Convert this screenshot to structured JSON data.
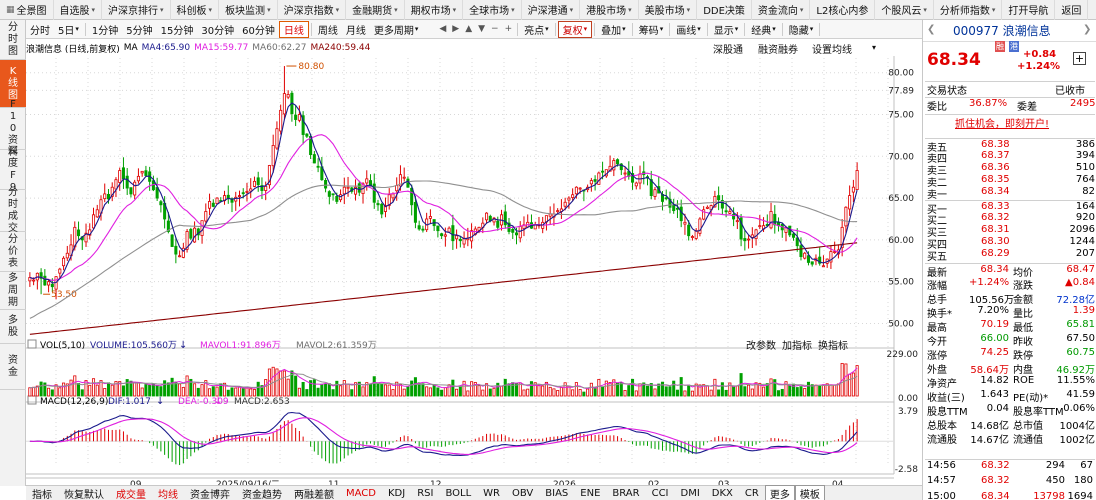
{
  "top_menu": [
    {
      "label": "全景图",
      "icon": "grid-icon"
    },
    {
      "label": "自选股",
      "dd": true
    },
    {
      "label": "沪深京排行",
      "dd": true
    },
    {
      "label": "科创板",
      "dd": true
    },
    {
      "label": "板块监测",
      "dd": true
    },
    {
      "label": "沪深京指数",
      "dd": true
    },
    {
      "label": "金融期货",
      "dd": true
    },
    {
      "label": "期权市场",
      "dd": true
    },
    {
      "label": "全球市场",
      "dd": true
    },
    {
      "label": "沪深港通",
      "dd": true
    },
    {
      "label": "港股市场",
      "dd": true
    },
    {
      "label": "美股市场",
      "dd": true
    },
    {
      "label": "DDE决策",
      "dd": false
    },
    {
      "label": "资金流向",
      "dd": true
    },
    {
      "label": "L2核心内参",
      "dd": false
    },
    {
      "label": "个股风云",
      "dd": true
    },
    {
      "label": "分析师指数",
      "dd": true
    },
    {
      "label": "打开导航",
      "dd": false
    },
    {
      "label": "返回",
      "dd": false
    }
  ],
  "toolbar": {
    "periods": [
      "分时",
      "5日",
      "1分钟",
      "5分钟",
      "15分钟",
      "30分钟",
      "60分钟",
      "日线",
      "周线",
      "月线",
      "更多周期"
    ],
    "active_period": "日线",
    "tools": [
      "亮点",
      "复权",
      "叠加",
      "筹码",
      "画线",
      "显示",
      "经典",
      "隐藏"
    ]
  },
  "left_tabs": [
    {
      "label": "分时图",
      "active": false
    },
    {
      "label": "K线图",
      "active": true
    },
    {
      "label": "F10资料",
      "active": false
    },
    {
      "label": "深度F9",
      "active": false
    },
    {
      "label": "分时成交",
      "active": false
    },
    {
      "label": "分价表",
      "active": false
    },
    {
      "label": "多周期",
      "active": false
    },
    {
      "label": "多股",
      "active": false
    },
    {
      "label": "资金",
      "active": false
    }
  ],
  "chart_header": {
    "title": "浪潮信息 (日线,前复权)",
    "ma_label": "MA",
    "ma4": "MA4:65.90",
    "ma15": "MA15:59.77",
    "ma60": "MA60:62.27",
    "ma240": "MA240:59.44",
    "buttons": [
      "深股通",
      "融资融券",
      "设置均线"
    ]
  },
  "volume_header": {
    "title": "VOL(5,10)",
    "volume": "VOLUME:105.560万",
    "mavol1": "MAVOL1:91.896万",
    "mavol2": "MAVOL2:61.359万",
    "buttons": [
      "改参数",
      "加指标",
      "换指标"
    ]
  },
  "macd_header": {
    "title": "MACD(12,26,9)",
    "dif": "DIF:1.017",
    "dea": "DEA:-0.309",
    "macd": "MACD:2.653"
  },
  "date_axis": [
    "09",
    "2025/09/16/二",
    "11",
    "12",
    "2026",
    "02",
    "03",
    "04"
  ],
  "bottom_tabs": [
    "指标",
    "恢复默认",
    "成交量",
    "均线",
    "资金博弈",
    "资金趋势",
    "两融差额",
    "MACD",
    "KDJ",
    "RSI",
    "BOLL",
    "WR",
    "OBV",
    "BIAS",
    "ENE",
    "BRAR",
    "CCI",
    "DMI",
    "DKX",
    "CR",
    "更多",
    "模板"
  ],
  "bottom_selected": [
    "成交量",
    "均线",
    "MACD"
  ],
  "quote": {
    "code": "000977 浪潮信息",
    "tags": [
      "融",
      "港"
    ],
    "price": "68.34",
    "change": "+0.84",
    "change_pct": "+1.24%",
    "status_label": "交易状态",
    "status_value": "已收市",
    "weibi_label": "委比",
    "weibi": "36.87%",
    "weicha_label": "委差",
    "weicha": "2495",
    "promo": "抓住机会，即刻开户!",
    "asks": [
      {
        "label": "卖五",
        "price": "68.38",
        "vol": "386"
      },
      {
        "label": "卖四",
        "price": "68.37",
        "vol": "394"
      },
      {
        "label": "卖三",
        "price": "68.36",
        "vol": "510"
      },
      {
        "label": "卖二",
        "price": "68.35",
        "vol": "764"
      },
      {
        "label": "卖一",
        "price": "68.34",
        "vol": "82"
      }
    ],
    "bids": [
      {
        "label": "买一",
        "price": "68.33",
        "vol": "164"
      },
      {
        "label": "买二",
        "price": "68.32",
        "vol": "920"
      },
      {
        "label": "买三",
        "price": "68.31",
        "vol": "2096"
      },
      {
        "label": "买四",
        "price": "68.30",
        "vol": "1244"
      },
      {
        "label": "买五",
        "price": "68.29",
        "vol": "207"
      }
    ],
    "stats": [
      {
        "l1": "最新",
        "v1": "68.34",
        "c1": "red",
        "l2": "均价",
        "v2": "68.47",
        "c2": "red"
      },
      {
        "l1": "涨幅",
        "v1": "+1.24%",
        "c1": "red",
        "l2": "涨跌",
        "v2": "▲0.84",
        "c2": "red"
      },
      {
        "l1": "总手",
        "v1": "105.56万",
        "c1": "",
        "l2": "金额",
        "v2": "72.28亿",
        "c2": "blu"
      },
      {
        "l1": "换手*",
        "v1": "7.20%",
        "c1": "",
        "l2": "量比",
        "v2": "1.39",
        "c2": "red"
      },
      {
        "l1": "最高",
        "v1": "70.19",
        "c1": "red",
        "l2": "最低",
        "v2": "65.81",
        "c2": "grn"
      },
      {
        "l1": "今开",
        "v1": "66.00",
        "c1": "grn",
        "l2": "昨收",
        "v2": "67.50",
        "c2": ""
      },
      {
        "l1": "涨停",
        "v1": "74.25",
        "c1": "red",
        "l2": "跌停",
        "v2": "60.75",
        "c2": "grn"
      },
      {
        "l1": "外盘",
        "v1": "58.64万",
        "c1": "red",
        "l2": "内盘",
        "v2": "46.92万",
        "c2": "grn"
      },
      {
        "l1": "净资产",
        "v1": "14.82",
        "c1": "",
        "l2": "ROE",
        "v2": "11.55%",
        "c2": ""
      },
      {
        "l1": "收益(三)",
        "v1": "1.643",
        "c1": "",
        "l2": "PE(动)*",
        "v2": "41.59",
        "c2": ""
      },
      {
        "l1": "股息TTM",
        "v1": "0.04",
        "c1": "",
        "l2": "股息率TTM",
        "v2": "0.06%",
        "c2": ""
      },
      {
        "l1": "总股本",
        "v1": "14.68亿",
        "c1": "",
        "l2": "总市值",
        "v2": "1004亿",
        "c2": ""
      },
      {
        "l1": "流通股",
        "v1": "14.67亿",
        "c1": "",
        "l2": "流通值",
        "v2": "1002亿",
        "c2": ""
      }
    ],
    "ticks": [
      {
        "time": "14:56",
        "price": "68.32",
        "vol": "294",
        "n": "67"
      },
      {
        "time": "14:57",
        "price": "68.32",
        "vol": "450",
        "n": "180"
      },
      {
        "time": "15:00",
        "price": "68.34",
        "vol": "13798",
        "n": "1694"
      }
    ]
  },
  "colors": {
    "up": "#e00000",
    "down": "#00a000",
    "ma4": "#1a1a8c",
    "ma15": "#e020e0",
    "ma60": "#909090",
    "ma240": "#8b0000",
    "accent": "#e8581c"
  },
  "chart_data": {
    "type": "candlestick",
    "price_axis": {
      "ticks": [
        "80.00",
        "77.89",
        "75.00",
        "70.00",
        "65.00",
        "60.00",
        "55.00",
        "50.00"
      ],
      "ylim": [
        48.5,
        82
      ]
    },
    "volume_axis": {
      "ticks": [
        "229.00",
        "0.00"
      ],
      "ylim": [
        0,
        229
      ]
    },
    "macd_axis": {
      "ticks": [
        "3.79",
        "-2.58"
      ],
      "ylim": [
        -2.8,
        4
      ]
    },
    "annotations": {
      "high_label": "80.80",
      "low_label": "53.50"
    },
    "close": [
      55.5,
      55.2,
      56.0,
      55.4,
      54.6,
      55.0,
      54.4,
      55.6,
      56.5,
      57.8,
      58.4,
      59.4,
      61.5,
      60.5,
      60.0,
      60.8,
      61.2,
      63.0,
      63.6,
      64.8,
      65.5,
      64.9,
      66.3,
      67.2,
      68.3,
      67.3,
      66.2,
      65.5,
      66.9,
      67.6,
      68.2,
      67.7,
      67.0,
      66.0,
      65.0,
      64.2,
      62.5,
      61.0,
      59.2,
      58.3,
      58.1,
      59.0,
      61.0,
      60.2,
      61.4,
      60.6,
      62.3,
      63.4,
      64.6,
      64.0,
      65.0,
      64.6,
      65.3,
      65.0,
      64.5,
      65.1,
      65.3,
      65.6,
      65.8,
      66.1,
      67.0,
      66.6,
      65.9,
      66.4,
      68.9,
      71.3,
      73.3,
      75.5,
      77.5,
      77.4,
      75.1,
      74.4,
      75.0,
      72.6,
      72.4,
      70.2,
      69.2,
      68.7,
      67.2,
      66.2,
      65.2,
      65.4,
      64.6,
      65.4,
      66.3,
      66.3,
      65.8,
      66.3,
      65.7,
      66.7,
      67.3,
      66.5,
      64.5,
      64.2,
      63.1,
      64.1,
      65.4,
      65.5,
      66.5,
      67.8,
      67.5,
      66.3,
      64.2,
      62.1,
      61.3,
      61.2,
      62.5,
      62.8,
      61.7,
      61.1,
      60.5,
      60.6,
      61.4,
      59.9,
      60.5,
      59.9,
      60.2,
      60.2,
      61.1,
      61.3,
      61.5,
      62.0,
      63.2,
      62.3,
      62.6,
      61.5,
      63.0,
      61.8,
      61.0,
      60.9,
      60.6,
      61.6,
      61.8,
      62.1,
      61.4,
      61.8,
      61.8,
      62.1,
      62.9,
      63.1,
      63.1,
      63.5,
      63.7,
      64.5,
      65.0,
      65.4,
      66.3,
      66.2,
      65.9,
      66.3,
      67.1,
      67.0,
      68.0,
      68.1,
      68.4,
      68.8,
      69.5,
      69.1,
      68.4,
      68.0,
      67.6,
      66.9,
      66.8,
      67.9,
      67.8,
      67.4,
      65.3,
      66.0,
      65.6,
      64.6,
      65.0,
      63.9,
      63.5,
      63.7,
      62.3,
      62.1,
      60.5,
      60.4,
      61.1,
      62.5,
      63.6,
      63.9,
      64.1,
      65.2,
      64.8,
      63.8,
      63.4,
      63.4,
      62.5,
      62.3,
      60.1,
      59.9,
      60.1,
      60.6,
      61.2,
      61.7,
      61.7,
      61.7,
      63.4,
      61.8,
      61.7,
      61.2,
      61.5,
      60.6,
      60.3,
      59.3,
      58.0,
      58.4,
      57.3,
      57.1,
      57.8,
      57.2,
      56.9,
      57.7,
      58.6,
      58.6,
      58.8,
      61.5,
      63.9,
      65.3,
      66.3,
      68.3
    ],
    "volume_range_note": "daily bars, dates from ~2025-08 to 2026-04"
  }
}
